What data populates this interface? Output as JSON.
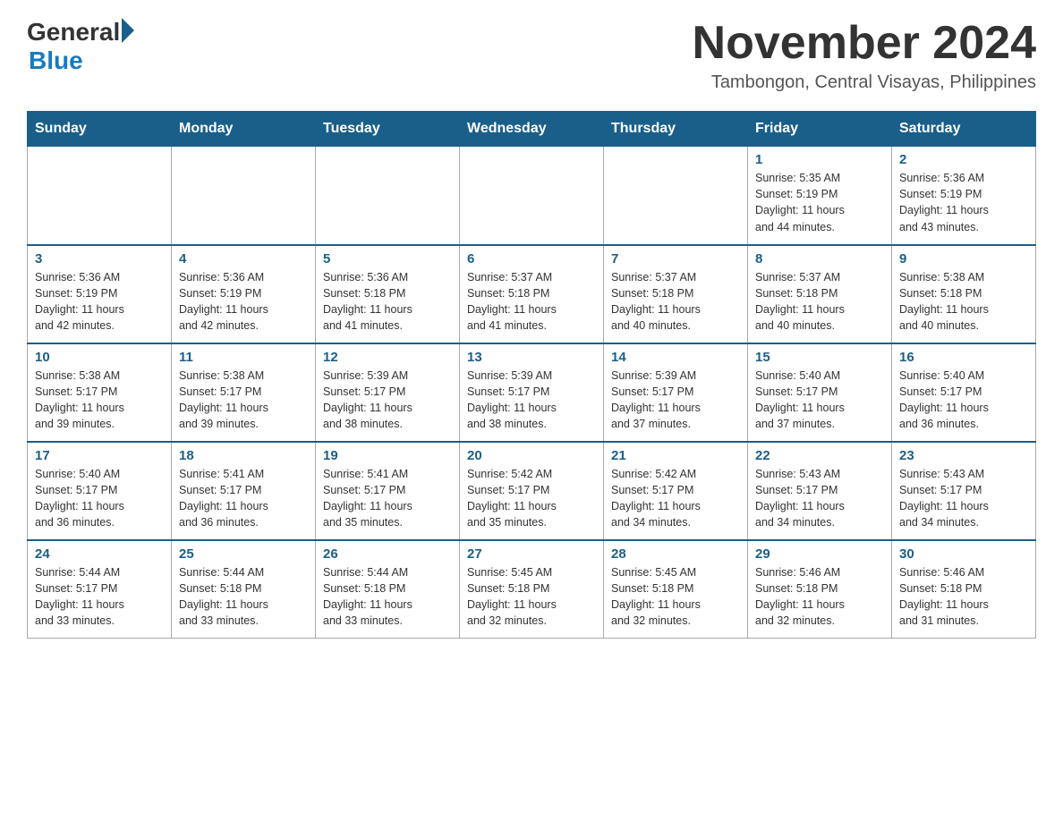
{
  "header": {
    "logo_general": "General",
    "logo_blue": "Blue",
    "month_title": "November 2024",
    "location": "Tambongon, Central Visayas, Philippines"
  },
  "days_of_week": [
    "Sunday",
    "Monday",
    "Tuesday",
    "Wednesday",
    "Thursday",
    "Friday",
    "Saturday"
  ],
  "weeks": [
    [
      {
        "day": "",
        "info": ""
      },
      {
        "day": "",
        "info": ""
      },
      {
        "day": "",
        "info": ""
      },
      {
        "day": "",
        "info": ""
      },
      {
        "day": "",
        "info": ""
      },
      {
        "day": "1",
        "info": "Sunrise: 5:35 AM\nSunset: 5:19 PM\nDaylight: 11 hours\nand 44 minutes."
      },
      {
        "day": "2",
        "info": "Sunrise: 5:36 AM\nSunset: 5:19 PM\nDaylight: 11 hours\nand 43 minutes."
      }
    ],
    [
      {
        "day": "3",
        "info": "Sunrise: 5:36 AM\nSunset: 5:19 PM\nDaylight: 11 hours\nand 42 minutes."
      },
      {
        "day": "4",
        "info": "Sunrise: 5:36 AM\nSunset: 5:19 PM\nDaylight: 11 hours\nand 42 minutes."
      },
      {
        "day": "5",
        "info": "Sunrise: 5:36 AM\nSunset: 5:18 PM\nDaylight: 11 hours\nand 41 minutes."
      },
      {
        "day": "6",
        "info": "Sunrise: 5:37 AM\nSunset: 5:18 PM\nDaylight: 11 hours\nand 41 minutes."
      },
      {
        "day": "7",
        "info": "Sunrise: 5:37 AM\nSunset: 5:18 PM\nDaylight: 11 hours\nand 40 minutes."
      },
      {
        "day": "8",
        "info": "Sunrise: 5:37 AM\nSunset: 5:18 PM\nDaylight: 11 hours\nand 40 minutes."
      },
      {
        "day": "9",
        "info": "Sunrise: 5:38 AM\nSunset: 5:18 PM\nDaylight: 11 hours\nand 40 minutes."
      }
    ],
    [
      {
        "day": "10",
        "info": "Sunrise: 5:38 AM\nSunset: 5:17 PM\nDaylight: 11 hours\nand 39 minutes."
      },
      {
        "day": "11",
        "info": "Sunrise: 5:38 AM\nSunset: 5:17 PM\nDaylight: 11 hours\nand 39 minutes."
      },
      {
        "day": "12",
        "info": "Sunrise: 5:39 AM\nSunset: 5:17 PM\nDaylight: 11 hours\nand 38 minutes."
      },
      {
        "day": "13",
        "info": "Sunrise: 5:39 AM\nSunset: 5:17 PM\nDaylight: 11 hours\nand 38 minutes."
      },
      {
        "day": "14",
        "info": "Sunrise: 5:39 AM\nSunset: 5:17 PM\nDaylight: 11 hours\nand 37 minutes."
      },
      {
        "day": "15",
        "info": "Sunrise: 5:40 AM\nSunset: 5:17 PM\nDaylight: 11 hours\nand 37 minutes."
      },
      {
        "day": "16",
        "info": "Sunrise: 5:40 AM\nSunset: 5:17 PM\nDaylight: 11 hours\nand 36 minutes."
      }
    ],
    [
      {
        "day": "17",
        "info": "Sunrise: 5:40 AM\nSunset: 5:17 PM\nDaylight: 11 hours\nand 36 minutes."
      },
      {
        "day": "18",
        "info": "Sunrise: 5:41 AM\nSunset: 5:17 PM\nDaylight: 11 hours\nand 36 minutes."
      },
      {
        "day": "19",
        "info": "Sunrise: 5:41 AM\nSunset: 5:17 PM\nDaylight: 11 hours\nand 35 minutes."
      },
      {
        "day": "20",
        "info": "Sunrise: 5:42 AM\nSunset: 5:17 PM\nDaylight: 11 hours\nand 35 minutes."
      },
      {
        "day": "21",
        "info": "Sunrise: 5:42 AM\nSunset: 5:17 PM\nDaylight: 11 hours\nand 34 minutes."
      },
      {
        "day": "22",
        "info": "Sunrise: 5:43 AM\nSunset: 5:17 PM\nDaylight: 11 hours\nand 34 minutes."
      },
      {
        "day": "23",
        "info": "Sunrise: 5:43 AM\nSunset: 5:17 PM\nDaylight: 11 hours\nand 34 minutes."
      }
    ],
    [
      {
        "day": "24",
        "info": "Sunrise: 5:44 AM\nSunset: 5:17 PM\nDaylight: 11 hours\nand 33 minutes."
      },
      {
        "day": "25",
        "info": "Sunrise: 5:44 AM\nSunset: 5:18 PM\nDaylight: 11 hours\nand 33 minutes."
      },
      {
        "day": "26",
        "info": "Sunrise: 5:44 AM\nSunset: 5:18 PM\nDaylight: 11 hours\nand 33 minutes."
      },
      {
        "day": "27",
        "info": "Sunrise: 5:45 AM\nSunset: 5:18 PM\nDaylight: 11 hours\nand 32 minutes."
      },
      {
        "day": "28",
        "info": "Sunrise: 5:45 AM\nSunset: 5:18 PM\nDaylight: 11 hours\nand 32 minutes."
      },
      {
        "day": "29",
        "info": "Sunrise: 5:46 AM\nSunset: 5:18 PM\nDaylight: 11 hours\nand 32 minutes."
      },
      {
        "day": "30",
        "info": "Sunrise: 5:46 AM\nSunset: 5:18 PM\nDaylight: 11 hours\nand 31 minutes."
      }
    ]
  ]
}
